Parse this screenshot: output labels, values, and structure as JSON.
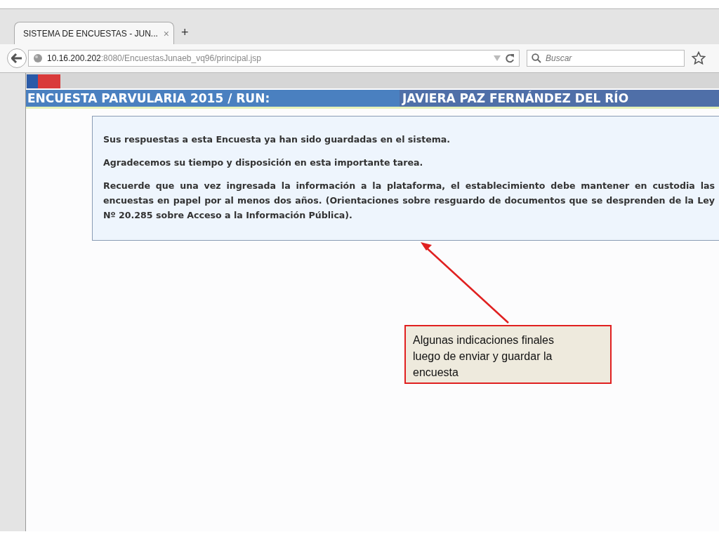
{
  "browser": {
    "tab": {
      "title": "SISTEMA DE ENCUESTAS - JUN...",
      "close": "×"
    },
    "new_tab": "+",
    "address": {
      "host": "10.16.200.202",
      "path": ":8080/EncuestasJunaeb_vq96/principal.jsp"
    },
    "search": {
      "placeholder": "Buscar"
    }
  },
  "page": {
    "banner": {
      "title": "ENCUESTA PARVULARIA 2015 / RUN:",
      "name": "JAVIERA PAZ FERNÁNDEZ DEL RÍO"
    },
    "message": [
      "Sus respuestas a esta Encuesta ya han sido guardadas en el sistema.",
      "Agradecemos su tiempo y disposición en esta importante tarea.",
      "Recuerde que una vez ingresada la información a la plataforma, el establecimiento debe mantener en custodia las encuestas en papel por al menos dos años. (Orientaciones sobre resguardo de documentos que se desprenden de la Ley Nº 20.285 sobre Acceso a la Información Pública)."
    ]
  },
  "callout": {
    "text": "Algunas indicaciones finales luego de enviar y guardar la encuesta"
  }
}
